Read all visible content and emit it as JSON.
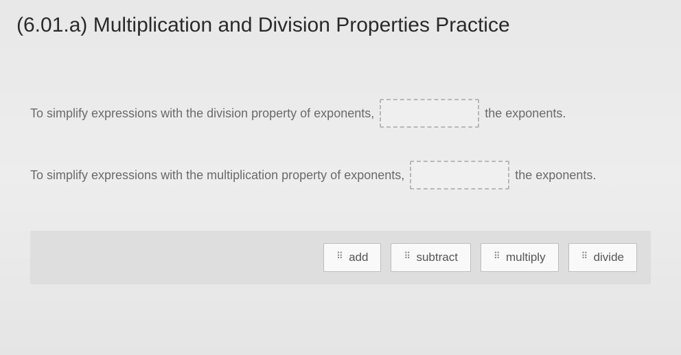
{
  "title": "(6.01.a) Multiplication and Division Properties Practice",
  "sentences": [
    {
      "before": "To simplify expressions with the division property of exponents,",
      "after": "the exponents."
    },
    {
      "before": "To simplify expressions with the multiplication property of exponents,",
      "after": "the exponents."
    }
  ],
  "options": [
    {
      "label": "add"
    },
    {
      "label": "subtract"
    },
    {
      "label": "multiply"
    },
    {
      "label": "divide"
    }
  ]
}
